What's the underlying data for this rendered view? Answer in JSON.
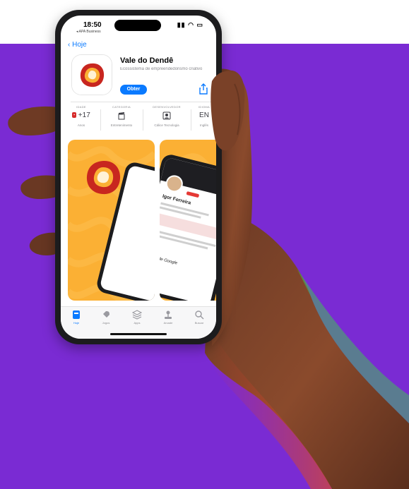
{
  "status_bar": {
    "time": "18:50",
    "carrier": "◂ APA Business",
    "icons": "▮▮ ◠ ▭"
  },
  "nav": {
    "back_label": "Hoje"
  },
  "app": {
    "title": "Vale do Dendê",
    "subtitle": "Ecossistema de empreendedorismo criativo",
    "get_label": "Obter"
  },
  "info": [
    {
      "caption": "IDADE",
      "value": "+17",
      "sub": "Anos"
    },
    {
      "caption": "CATEGORIA",
      "value": "",
      "sub": "Entretenimento"
    },
    {
      "caption": "DESENVOLVEDOR",
      "value": "",
      "sub": "Cálice Tecnologia"
    },
    {
      "caption": "IDIOMA",
      "value": "EN",
      "sub": "Inglês"
    }
  ],
  "screenshot_2": {
    "profile_name": "Igor Ferreira",
    "caption": "Links de Google"
  },
  "tabs": [
    {
      "label": "Hoje",
      "active": true
    },
    {
      "label": "Jogos",
      "active": false
    },
    {
      "label": "Apps",
      "active": false
    },
    {
      "label": "Arcade",
      "active": false
    },
    {
      "label": "Buscar",
      "active": false
    }
  ],
  "colors": {
    "background_purple": "#7a2bd3",
    "accent_blue": "#0a7aff",
    "brand_orange": "#fbb034",
    "brand_red": "#c8261f"
  }
}
